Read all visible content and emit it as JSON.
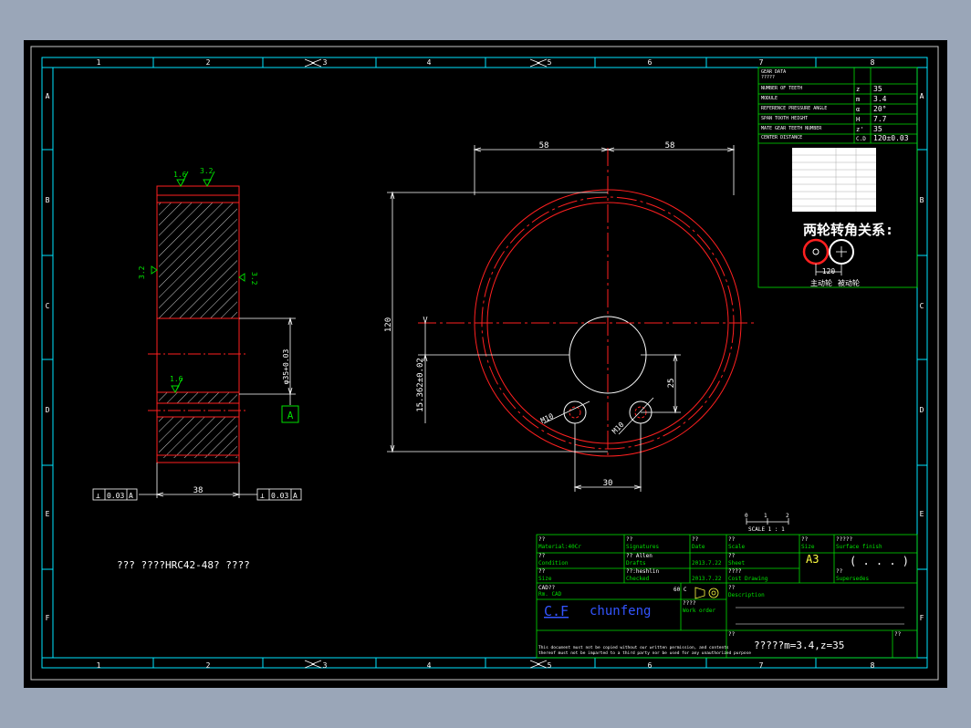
{
  "colors": {
    "background": "#9aa6b8",
    "sheet": "#000000",
    "frame": "#00e5ff",
    "outline": "#ff2020",
    "dim": "#ffffff",
    "table": "#00e000",
    "surface": "#00ff00",
    "accent": "#ffff40"
  },
  "grid": {
    "columns": [
      "1",
      "2",
      "3",
      "4",
      "5",
      "6",
      "7",
      "8"
    ],
    "rows": [
      "A",
      "B",
      "C",
      "D",
      "E",
      "F"
    ]
  },
  "gear_data": {
    "header": [
      "GEAR DATA",
      "?????"
    ],
    "rows": [
      {
        "label": "NUMBER OF TEETH",
        "sym": "z",
        "value": "35"
      },
      {
        "label": "MODULE",
        "sym": "m",
        "value": "3.4"
      },
      {
        "label": "REFERENCE PRESSURE ANGLE",
        "sym": "α",
        "value": "20°"
      },
      {
        "label": "SPAN TOOTH HEIGHT",
        "sym": "H",
        "value": "7.7"
      },
      {
        "label": "MATE GEAR TEETH NUMBER",
        "sym": "z'",
        "value": "35"
      },
      {
        "label": "CENTER DISTANCE",
        "sym": "C.D",
        "value": "120±0.03"
      }
    ]
  },
  "relation": {
    "title": "两轮转角关系:",
    "dim": "120",
    "driver": "主动轮",
    "driven": "被动轮"
  },
  "side_view": {
    "roughness": [
      "1.6",
      "3.2",
      "3.2",
      "3.2",
      "1.6"
    ],
    "bore_dim": "φ35+0.03",
    "datum": "A",
    "width_dim": "38",
    "tol_left": {
      "sym": "⊥",
      "value": "0.03",
      "datum": "A"
    },
    "tol_right": {
      "sym": "⊥",
      "value": "0.03",
      "datum": "A"
    }
  },
  "front_view": {
    "dim_left": "58",
    "dim_right": "58",
    "dim_height": "120",
    "dim_center": "15.362±0.02",
    "dim_hole_v": "25",
    "dim_hole_h": "30",
    "thread1": "M10",
    "thread2": "M10"
  },
  "note": "??? ????HRC42-48? ????",
  "scale_bar": {
    "ticks": [
      "0",
      "1",
      "2"
    ],
    "label": "SCALE 1 : 1"
  },
  "title_block": {
    "material_cn": "??",
    "material": "Material:40Cr",
    "signatures_cn": "??",
    "signatures": "Signatures",
    "date_cn": "??",
    "date_label": "Date",
    "scale_cn": "??",
    "scale_label": "Scale",
    "size_cn": "??",
    "size_label": "Size",
    "finish_cn": "?????",
    "finish_label": "Surface finish",
    "condition_cn": "??",
    "condition": "Condition",
    "drafter": "?? Allen",
    "drafter_label": "Drafts",
    "date1": "2013.7.22",
    "sheet_cn": "??",
    "sheet_label": "Sheet",
    "size_value": "A3",
    "finish_value": "( . . . )",
    "size2_cn": "??",
    "size2_label": "Size",
    "checker": "??:heshlin",
    "checker_label": "Checked",
    "date2": "2013.7.22",
    "cost_cn": "????",
    "cost_label": "Cost  Drawing",
    "super_cn": "??",
    "super_label": "Supersedes",
    "cad": "CAD??",
    "cad_label": "Rm. CAD",
    "projection": "60 C",
    "desc_cn": "??",
    "desc_label": "Description",
    "company1": "C.F",
    "company2": "chunfeng",
    "workorder_cn": "????",
    "workorder_label": "Work order",
    "part_cn": "??",
    "part_name": "?????m=3.4,z=35",
    "part_cn2": "??",
    "legal1": "This document must not be copied without our written permission, and contents",
    "legal2": "thereof must not be imparted to a third party nor be used for any unauthorized purpose"
  }
}
